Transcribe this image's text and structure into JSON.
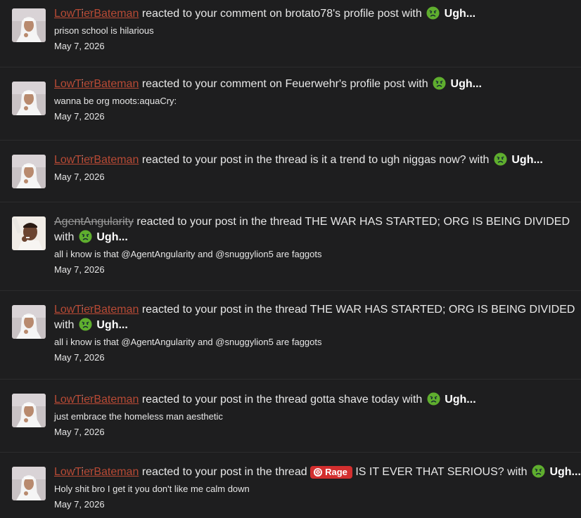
{
  "notifications": [
    {
      "user": "LowTierBateman",
      "user_style": "red",
      "avatar": "man-in-white-headdress",
      "action": "reacted to your comment on",
      "target": "brotato78's profile post with",
      "reaction": "Ugh...",
      "snippet": "prison school is hilarious",
      "date": "May 7, 2026"
    },
    {
      "user": "LowTierBateman",
      "user_style": "red",
      "avatar": "man-in-white-headdress",
      "action": "reacted to your comment on",
      "target": "Feuerwehr's profile post with",
      "reaction": "Ugh...",
      "snippet": "wanna be org moots:aquaCry:",
      "date": "May 7, 2026"
    },
    {
      "user": "LowTierBateman",
      "user_style": "red",
      "avatar": "man-in-white-headdress",
      "action": "reacted to your post in the thread",
      "target": "is it a trend to ugh niggas now? with",
      "reaction": "Ugh...",
      "snippet": "",
      "date": "May 7, 2026"
    },
    {
      "user": "AgentAngularity",
      "user_style": "strike",
      "avatar": "man-smoking",
      "action": "reacted to your post in the thread",
      "target": "THE WAR HAS STARTED; ORG IS BEING DIVIDED with",
      "reaction": "Ugh...",
      "snippet": "all i know is that @AgentAngularity and @snuggylion5 are faggots",
      "date": "May 7, 2026"
    },
    {
      "user": "LowTierBateman",
      "user_style": "red",
      "avatar": "man-in-white-headdress",
      "action": "reacted to your post in the thread",
      "target": "THE WAR HAS STARTED; ORG IS BEING DIVIDED with",
      "reaction": "Ugh...",
      "snippet": "all i know is that @AgentAngularity and @snuggylion5 are faggots",
      "date": "May 7, 2026"
    },
    {
      "user": "LowTierBateman",
      "user_style": "red",
      "avatar": "man-in-white-headdress",
      "action": "reacted to your post in the thread",
      "target": "gotta shave today with",
      "reaction": "Ugh...",
      "snippet": "just embrace the homeless man aesthetic",
      "date": "May 7, 2026"
    },
    {
      "user": "LowTierBateman",
      "user_style": "red",
      "avatar": "man-in-white-headdress",
      "action": "reacted to your post in the thread",
      "prefix": "Rage",
      "target": "IS IT EVER THAT SERIOUS? with",
      "reaction": "Ugh...",
      "snippet": "Holy shit bro I get it you don't like me calm down",
      "date": "May 7, 2026"
    }
  ],
  "colors": {
    "background": "#1e1e1f",
    "username_red": "#b84a35",
    "reaction_emoji_green": "#5fae2e",
    "prefix_red": "#d32f2f"
  },
  "icons": {
    "reaction": "angry-face-icon",
    "prefix": "rage-face-icon"
  }
}
